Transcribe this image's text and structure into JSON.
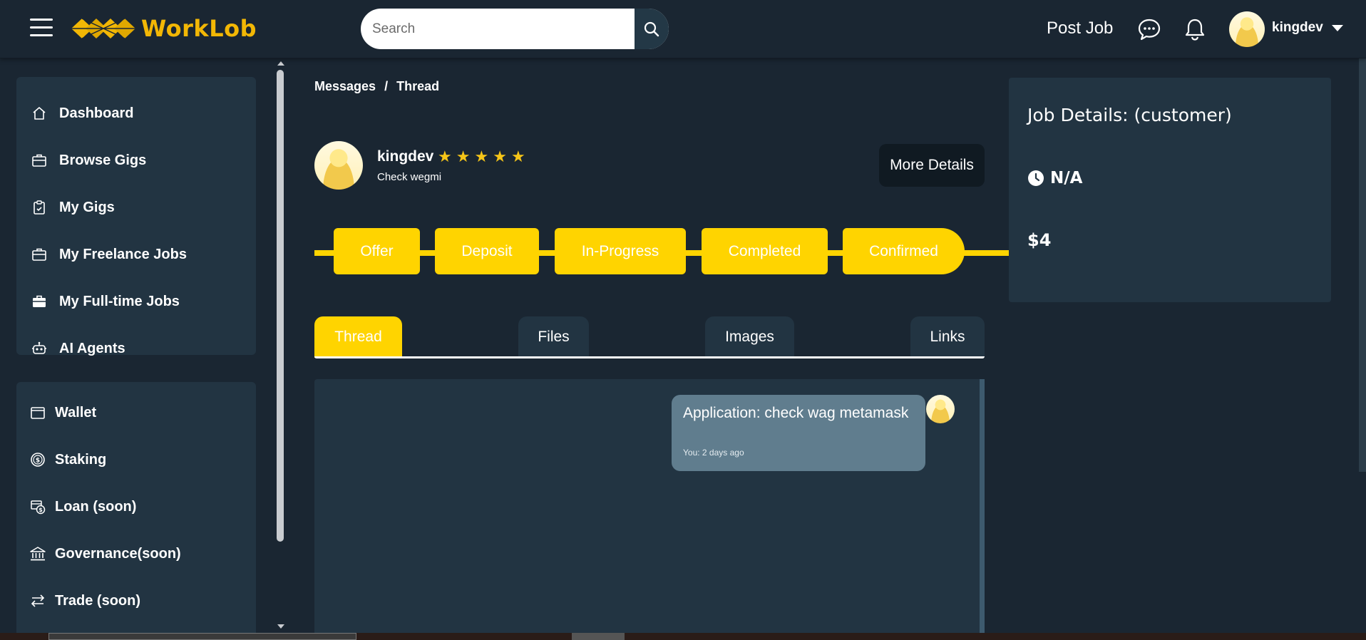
{
  "app": {
    "brand": "WorkLob",
    "colors": {
      "accent": "#ffd400",
      "brand": "#f2b705",
      "background": "#1a2632",
      "card": "#223442",
      "bubble": "#607d8e"
    }
  },
  "header": {
    "search_placeholder": "Search",
    "post_job_label": "Post Job",
    "username": "kingdev",
    "icons": [
      "menu-icon",
      "search-icon",
      "chat-icon",
      "bell-icon",
      "chevron-down-icon"
    ]
  },
  "sidebar": {
    "primary": [
      {
        "label": "Dashboard",
        "icon": "home-icon"
      },
      {
        "label": "Browse Gigs",
        "icon": "briefcase-icon"
      },
      {
        "label": "My Gigs",
        "icon": "clipboard-icon"
      },
      {
        "label": "My Freelance Jobs",
        "icon": "briefcase-icon"
      },
      {
        "label": "My Full-time Jobs",
        "icon": "briefcase-filled-icon"
      },
      {
        "label": "AI Agents",
        "icon": "robot-icon"
      }
    ],
    "secondary": [
      {
        "label": "Wallet",
        "icon": "wallet-icon"
      },
      {
        "label": "Staking",
        "icon": "dollar-circle-icon"
      },
      {
        "label": "Loan (soon)",
        "icon": "loan-icon"
      },
      {
        "label": "Governance(soon)",
        "icon": "bank-icon"
      },
      {
        "label": "Trade (soon)",
        "icon": "swap-icon"
      }
    ]
  },
  "breadcrumb": {
    "parent": "Messages",
    "separator": "/",
    "current": "Thread"
  },
  "contact": {
    "name": "kingdev",
    "rating": 5,
    "subtitle": "Check wegmi",
    "more_button": "More Details"
  },
  "stages": [
    "Offer",
    "Deposit",
    "In-Progress",
    "Completed",
    "Confirmed"
  ],
  "tabs": [
    "Thread",
    "Files",
    "Images",
    "Links"
  ],
  "active_tab": "Thread",
  "messages": [
    {
      "text": "Application: check wag metamask",
      "meta": "You: 2 days ago"
    }
  ],
  "job_details": {
    "title": "Job Details: (customer)",
    "duration": "N/A",
    "price": "$4"
  }
}
